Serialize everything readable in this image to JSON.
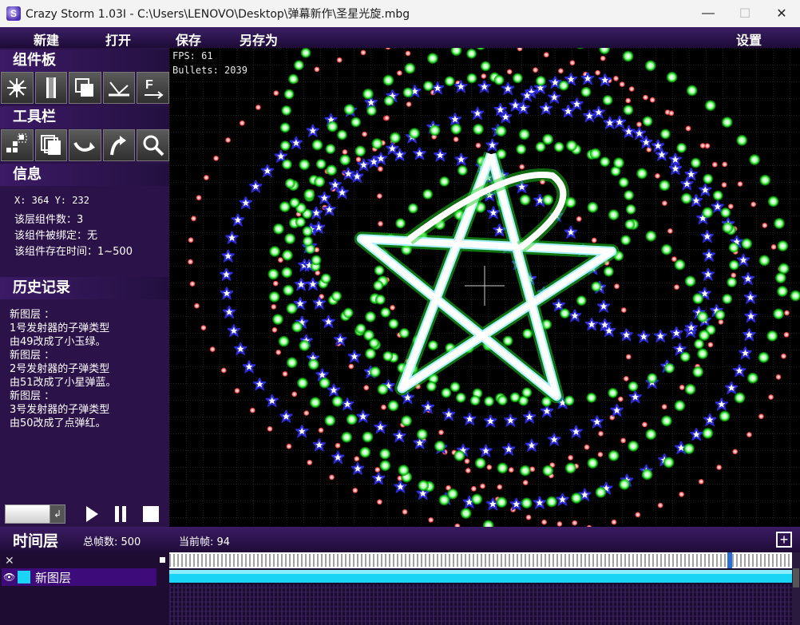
{
  "window": {
    "title": "Crazy Storm 1.03I - C:\\Users\\LENOVO\\Desktop\\弹幕新作\\圣星光旋.mbg",
    "minimize": "—",
    "maximize": "☐",
    "close": "✕"
  },
  "menu": {
    "new": "新建",
    "open": "打开",
    "save": "保存",
    "save_as": "另存为",
    "settings": "设置"
  },
  "panel": {
    "components_title": "组件板",
    "toolbar_title": "工具栏",
    "info_title": "信息",
    "history_title": "历史记录",
    "info": {
      "coords": "X: 364  Y: 232",
      "layer_count": "该层组件数：3",
      "bound": "该组件被绑定：无",
      "lifetime": "该组件存在时间：1~500"
    },
    "history": [
      "新图层 ：",
      "1号发射器的子弹类型",
      "由49改成了小玉绿。",
      "新图层 ：",
      "2号发射器的子弹类型",
      "由51改成了小星弹蓝。",
      "新图层 ：",
      "3号发射器的子弹类型",
      "由50改成了点弹红。"
    ],
    "component_tools": [
      "emitter-icon",
      "laser-icon",
      "layer-copy-icon",
      "rebound-icon",
      "force-field-icon"
    ],
    "toolbar_tools": [
      "select-multiple-icon",
      "stack-icon",
      "curve-arrow-icon",
      "rotate-arrow-icon",
      "magnify-icon"
    ]
  },
  "playback": {
    "enter_symbol": "↲"
  },
  "canvas": {
    "fps": "FPS: 61",
    "bullets": "Bullets: 2039"
  },
  "timeline": {
    "title": "时间层",
    "total_frames": "总帧数: 500",
    "current_frame": "当前帧: 94",
    "add_symbol": "+",
    "close_symbol": "✕",
    "layer_eye": "👁",
    "layer_name": "新图层",
    "layer_color": "#19d4f5",
    "total": 500,
    "current": 94
  },
  "colors": {
    "green_bullet": "#2fe82f",
    "blue_star": "#2a2ad0",
    "red_dot": "#e02020",
    "panel_bg": "#2b1248"
  }
}
